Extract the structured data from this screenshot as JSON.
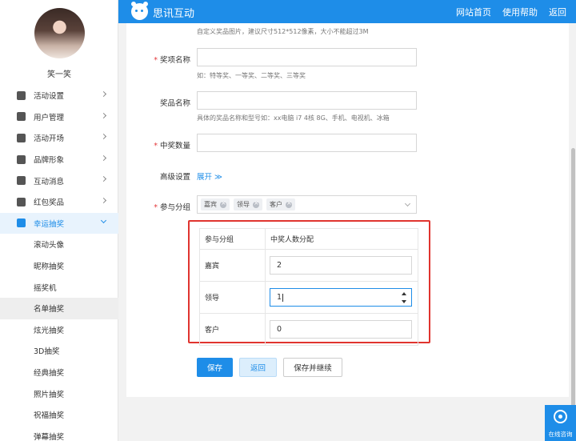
{
  "sidebar": {
    "username": "笑一笑",
    "menu": [
      {
        "label": "活动设置",
        "icon": "gear-icon"
      },
      {
        "label": "用户管理",
        "icon": "user-icon"
      },
      {
        "label": "活动开场",
        "icon": "send-icon"
      },
      {
        "label": "品牌形象",
        "icon": "registered-icon"
      },
      {
        "label": "互动消息",
        "icon": "message-icon"
      },
      {
        "label": "红包奖品",
        "icon": "gift-icon"
      },
      {
        "label": "幸运抽奖",
        "icon": "lottery-icon",
        "active": true
      }
    ],
    "sub_items": [
      "滚动头像",
      "昵称抽奖",
      "摇奖机",
      "名单抽奖",
      "炫光抽奖",
      "3D抽奖",
      "经典抽奖",
      "照片抽奖",
      "祝福抽奖",
      "弹幕抽奖"
    ],
    "selected_sub": "名单抽奖"
  },
  "header": {
    "brand": "思讯互动",
    "nav": [
      "网站首页",
      "使用帮助",
      "返回"
    ]
  },
  "form": {
    "image_hint": "自定义奖品图片，建议尺寸512*512像素，大小不能超过3M",
    "award_name_label": "奖项名称",
    "award_name_hint": "如：特等奖、一等奖、二等奖、三等奖",
    "prize_name_label": "奖品名称",
    "prize_name_hint": "具体的奖品名称和型号如：xx电脑 i7 4核 8G、手机、电视机、冰箱",
    "winner_count_label": "中奖数量",
    "advanced_label": "高级设置",
    "expand_label": "展开 ≫",
    "groups_label": "参与分组",
    "groups_tags": [
      "嘉宾",
      "领导",
      "客户"
    ]
  },
  "distribution": {
    "headers": [
      "参与分组",
      "中奖人数分配"
    ],
    "rows": [
      {
        "group": "嘉宾",
        "value": "2"
      },
      {
        "group": "领导",
        "value": "1"
      },
      {
        "group": "客户",
        "value": "0"
      }
    ]
  },
  "buttons": {
    "save": "保存",
    "back": "返回",
    "save_continue": "保存并继续"
  },
  "consult": {
    "label": "在线咨询"
  },
  "colors": {
    "primary": "#1e8de8",
    "highlight_border": "#e0342f",
    "required": "#e4393c"
  }
}
